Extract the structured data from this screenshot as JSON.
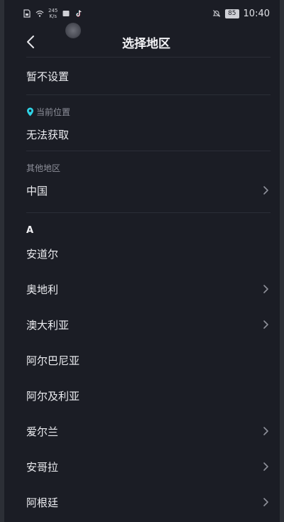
{
  "status_bar": {
    "net_speed_value": "245",
    "net_speed_unit": "K/s",
    "battery": "85",
    "time": "10:40"
  },
  "header": {
    "title": "选择地区"
  },
  "no_setting": {
    "label": "暂不设置"
  },
  "current_location": {
    "section_label": "当前位置",
    "value": "无法获取"
  },
  "other_regions": {
    "section_label": "其他地区",
    "item": "中国"
  },
  "index_letter": "A",
  "regions": [
    {
      "label": "安道尔",
      "has_chevron": false
    },
    {
      "label": "奥地利",
      "has_chevron": true
    },
    {
      "label": "澳大利亚",
      "has_chevron": true
    },
    {
      "label": "阿尔巴尼亚",
      "has_chevron": false
    },
    {
      "label": "阿尔及利亚",
      "has_chevron": false
    },
    {
      "label": "爱尔兰",
      "has_chevron": true
    },
    {
      "label": "安哥拉",
      "has_chevron": true
    },
    {
      "label": "阿根廷",
      "has_chevron": true
    }
  ],
  "colors": {
    "background": "#1b1d25",
    "accent_location": "#2fd3e6",
    "tiktok_red": "#fe2c55",
    "tiktok_cyan": "#25f4ee"
  }
}
